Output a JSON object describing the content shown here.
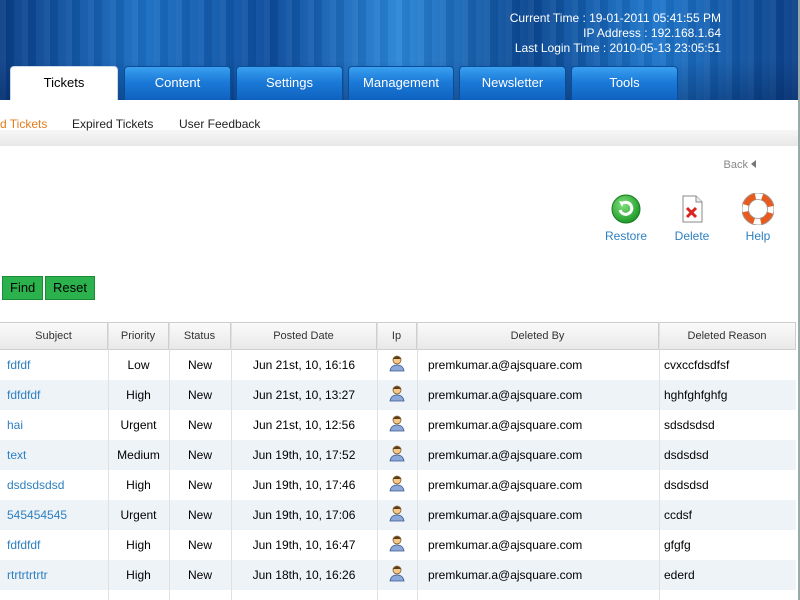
{
  "header": {
    "current_time": "Current Time : 19-01-2011 05:41:55 PM",
    "ip_address": "IP Address : 192.168.1.64",
    "last_login": "Last Login Time : 2010-05-13 23:05:51"
  },
  "tabs": [
    {
      "label": "Tickets",
      "active": true
    },
    {
      "label": "Content"
    },
    {
      "label": "Settings"
    },
    {
      "label": "Management"
    },
    {
      "label": "Newsletter"
    },
    {
      "label": "Tools"
    }
  ],
  "subnav": [
    "d Tickets",
    "Expired Tickets",
    "User Feedback"
  ],
  "back_label": "Back",
  "actions": {
    "restore": "Restore",
    "delete": "Delete",
    "help": "Help"
  },
  "buttons": {
    "find": "Find",
    "reset": "Reset"
  },
  "columns": [
    "Subject",
    "Priority",
    "Status",
    "Posted Date",
    "Ip",
    "Deleted By",
    "Deleted Reason"
  ],
  "rows": [
    {
      "subject": "fdfdf",
      "priority": "Low",
      "status": "New",
      "date": "Jun 21st, 10, 16:16",
      "deleted_by": "premkumar.a@ajsquare.com",
      "reason": "cvxccfdsdfsf"
    },
    {
      "subject": "fdfdfdf",
      "priority": "High",
      "status": "New",
      "date": "Jun 21st, 10, 13:27",
      "deleted_by": "premkumar.a@ajsquare.com",
      "reason": "hghfghfghfg"
    },
    {
      "subject": "hai",
      "priority": "Urgent",
      "status": "New",
      "date": "Jun 21st, 10, 12:56",
      "deleted_by": "premkumar.a@ajsquare.com",
      "reason": "sdsdsdsd"
    },
    {
      "subject": "text",
      "priority": "Medium",
      "status": "New",
      "date": "Jun 19th, 10, 17:52",
      "deleted_by": "premkumar.a@ajsquare.com",
      "reason": "dsdsdsd"
    },
    {
      "subject": "dsdsdsdsd",
      "priority": "High",
      "status": "New",
      "date": "Jun 19th, 10, 17:46",
      "deleted_by": "premkumar.a@ajsquare.com",
      "reason": "dsdsdsd"
    },
    {
      "subject": "545454545",
      "priority": "Urgent",
      "status": "New",
      "date": "Jun 19th, 10, 17:06",
      "deleted_by": "premkumar.a@ajsquare.com",
      "reason": "ccdsf"
    },
    {
      "subject": "fdfdfdf",
      "priority": "High",
      "status": "New",
      "date": "Jun 19th, 10, 16:47",
      "deleted_by": "premkumar.a@ajsquare.com",
      "reason": "gfgfg"
    },
    {
      "subject": "rtrtrtrtrtr",
      "priority": "High",
      "status": "New",
      "date": "Jun 18th, 10, 16:26",
      "deleted_by": "premkumar.a@ajsquare.com",
      "reason": "ederd"
    }
  ],
  "icons": {
    "ip": "user-icon",
    "restore": "restore-icon",
    "delete": "delete-document-icon",
    "help": "lifebuoy-help-icon"
  },
  "colors": {
    "accent": "#2d7fc1",
    "active_subnav": "#e37b1c",
    "button_green": "#2bb24c"
  }
}
